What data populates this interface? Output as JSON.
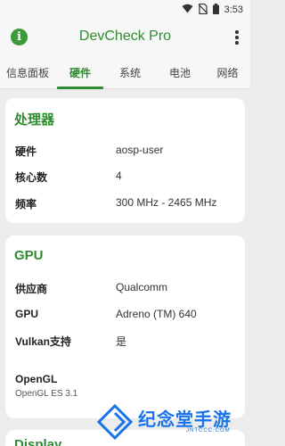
{
  "status_bar": {
    "time": "3:53"
  },
  "app_bar": {
    "title": "DevCheck Pro"
  },
  "tabs": [
    {
      "label": "信息面板"
    },
    {
      "label": "硬件"
    },
    {
      "label": "系统"
    },
    {
      "label": "电池"
    },
    {
      "label": "网络"
    }
  ],
  "processor_card": {
    "title": "处理器",
    "rows": [
      {
        "label": "硬件",
        "value": "aosp-user"
      },
      {
        "label": "核心数",
        "value": "4"
      },
      {
        "label": "频率",
        "value": "300 MHz - 2465 MHz"
      }
    ]
  },
  "gpu_card": {
    "title": "GPU",
    "rows": [
      {
        "label": "供应商",
        "value": "Qualcomm"
      },
      {
        "label": "GPU",
        "value": "Adreno (TM) 640"
      },
      {
        "label": "Vulkan支持",
        "value": "是"
      }
    ],
    "opengl_label": "OpenGL",
    "opengl_value": "OpenGL ES 3.1"
  },
  "display_card": {
    "title": "Display"
  },
  "watermark": {
    "brand": "纪念堂手游",
    "url": "JNTCCC.COM"
  },
  "colors": {
    "accent": "#2e8b2f",
    "background": "#ececec",
    "card": "#ffffff"
  }
}
